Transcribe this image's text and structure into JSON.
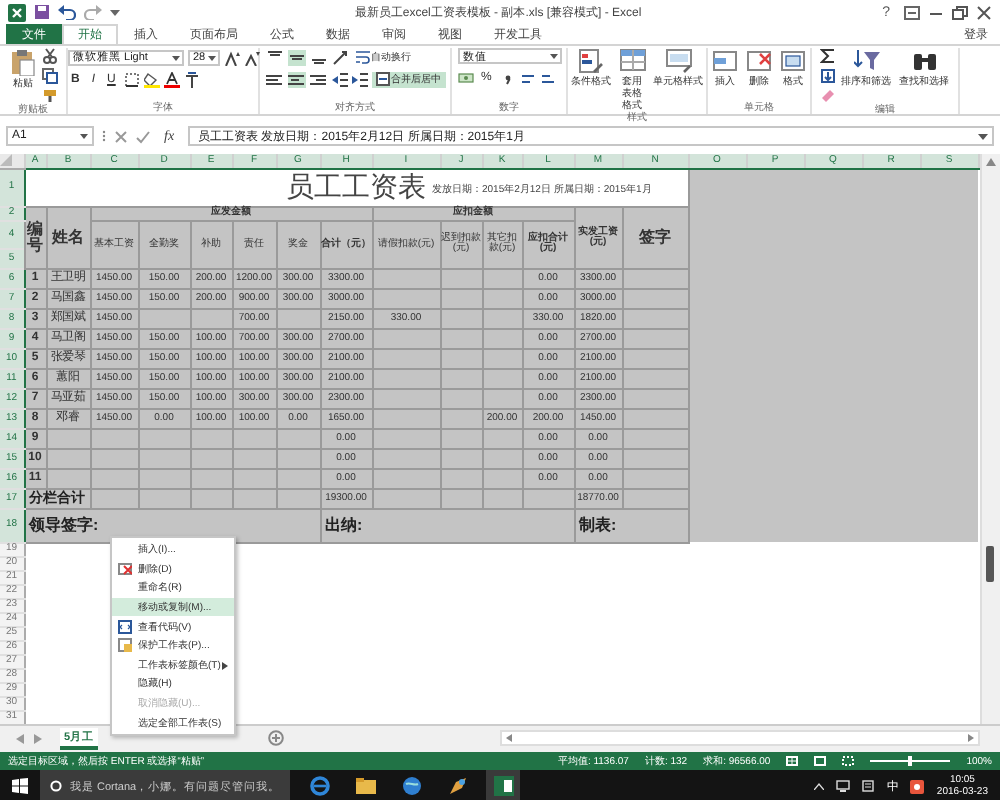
{
  "window": {
    "title": "最新员工excel工资表模板 - 副本.xls  [兼容模式] - Excel",
    "help": "?",
    "sign_in": "登录"
  },
  "ribbon": {
    "tabs": [
      {
        "label": "文件",
        "kind": "file",
        "selected": false
      },
      {
        "label": "开始",
        "kind": "tab",
        "selected": true
      },
      {
        "label": "插入",
        "kind": "tab",
        "selected": false
      },
      {
        "label": "页面布局",
        "kind": "tab",
        "selected": false
      },
      {
        "label": "公式",
        "kind": "tab",
        "selected": false
      },
      {
        "label": "数据",
        "kind": "tab",
        "selected": false
      },
      {
        "label": "审阅",
        "kind": "tab",
        "selected": false
      },
      {
        "label": "视图",
        "kind": "tab",
        "selected": false
      },
      {
        "label": "开发工具",
        "kind": "tab",
        "selected": false
      }
    ],
    "clipboard": {
      "label": "剪贴板",
      "paste": "粘贴"
    },
    "font": {
      "label": "字体",
      "name": "微软雅黑 Light",
      "size": "28",
      "styles": [
        "B",
        "I",
        "U"
      ]
    },
    "alignment": {
      "label": "对齐方式",
      "wrap": "自动换行",
      "merge": {
        "label": "合并后居中",
        "on": true
      },
      "vertical": [
        {
          "on": false
        },
        {
          "on": true
        },
        {
          "on": false
        }
      ],
      "horizontal": [
        {
          "on": false
        },
        {
          "on": true
        },
        {
          "on": false
        }
      ]
    },
    "number": {
      "label": "数字",
      "format": "数值",
      "percent": "%"
    },
    "styles": {
      "label": "样式",
      "buttons": [
        "条件格式",
        "套用表格格式",
        "单元格样式"
      ]
    },
    "cells": {
      "label": "单元格",
      "buttons": [
        "插入",
        "删除",
        "格式"
      ]
    },
    "editing": {
      "label": "编辑",
      "buttons": [
        "排序和筛选",
        "查找和选择"
      ]
    }
  },
  "formula_bar": {
    "name_box": "A1",
    "fx": "fx",
    "content": "员工工资表  发放日期：2015年2月12日  所属日期：2015年1月"
  },
  "sheet": {
    "columns": [
      {
        "label": "A",
        "selected": true
      },
      {
        "label": "B",
        "selected": true
      },
      {
        "label": "C",
        "selected": true
      },
      {
        "label": "D",
        "selected": true
      },
      {
        "label": "E",
        "selected": true
      },
      {
        "label": "F",
        "selected": true
      },
      {
        "label": "G",
        "selected": true
      },
      {
        "label": "H",
        "selected": true
      },
      {
        "label": "I",
        "selected": true
      },
      {
        "label": "J",
        "selected": true
      },
      {
        "label": "K",
        "selected": true
      },
      {
        "label": "L",
        "selected": true
      },
      {
        "label": "M",
        "selected": true
      },
      {
        "label": "N",
        "selected": true
      },
      {
        "label": "O",
        "selected": true
      },
      {
        "label": "P",
        "selected": true
      },
      {
        "label": "Q",
        "selected": true
      },
      {
        "label": "R",
        "selected": true
      },
      {
        "label": "S",
        "selected": true
      }
    ],
    "row_headers": [
      {
        "label": "1",
        "selected": true
      },
      {
        "label": "2",
        "selected": true
      },
      {
        "label": "4",
        "selected": true
      },
      {
        "label": "5",
        "selected": true
      },
      {
        "label": "6",
        "selected": true
      },
      {
        "label": "7",
        "selected": true
      },
      {
        "label": "8",
        "selected": true
      },
      {
        "label": "9",
        "selected": true
      },
      {
        "label": "10",
        "selected": true
      },
      {
        "label": "11",
        "selected": true
      },
      {
        "label": "12",
        "selected": true
      },
      {
        "label": "13",
        "selected": true
      },
      {
        "label": "14",
        "selected": true
      },
      {
        "label": "15",
        "selected": true
      },
      {
        "label": "16",
        "selected": true
      },
      {
        "label": "17",
        "selected": true
      },
      {
        "label": "18",
        "selected": true
      },
      {
        "label": "19",
        "selected": false
      },
      {
        "label": "20",
        "selected": false
      },
      {
        "label": "21",
        "selected": false
      },
      {
        "label": "22",
        "selected": false
      },
      {
        "label": "23",
        "selected": false
      },
      {
        "label": "24",
        "selected": false
      },
      {
        "label": "25",
        "selected": false
      },
      {
        "label": "26",
        "selected": false
      },
      {
        "label": "27",
        "selected": false
      },
      {
        "label": "28",
        "selected": false
      },
      {
        "label": "29",
        "selected": false
      },
      {
        "label": "30",
        "selected": false
      },
      {
        "label": "31",
        "selected": false
      }
    ],
    "title": "员工工资表",
    "date_line": "发放日期：2015年2月12日 所属日期：2015年1月",
    "head": {
      "number": "编号",
      "name": "姓名",
      "earnings": "应发金额",
      "deductions": "应扣金额",
      "net": "实发工资(元)",
      "signature": "签字",
      "earning_items": [
        "基本工资",
        "全勤奖",
        "补助",
        "责任",
        "奖金",
        "合计（元）"
      ],
      "deduction_items": [
        "请假扣款(元)",
        "迟到扣款(元)",
        "其它扣款(元)",
        "应扣合计(元)"
      ]
    },
    "rows": [
      [
        "1",
        "王卫明",
        "1450.00",
        "150.00",
        "200.00",
        "1200.00",
        "300.00",
        "3300.00",
        null,
        null,
        null,
        "0.00",
        "3300.00",
        null
      ],
      [
        "2",
        "马国鑫",
        "1450.00",
        "150.00",
        "200.00",
        "900.00",
        "300.00",
        "3000.00",
        null,
        null,
        null,
        "0.00",
        "3000.00",
        null
      ],
      [
        "3",
        "郑国斌",
        "1450.00",
        null,
        null,
        "700.00",
        null,
        "2150.00",
        "330.00",
        null,
        null,
        "330.00",
        "1820.00",
        null
      ],
      [
        "4",
        "马卫阁",
        "1450.00",
        "150.00",
        "100.00",
        "700.00",
        "300.00",
        "2700.00",
        null,
        null,
        null,
        "0.00",
        "2700.00",
        null
      ],
      [
        "5",
        "张爱琴",
        "1450.00",
        "150.00",
        "100.00",
        "100.00",
        "300.00",
        "2100.00",
        null,
        null,
        null,
        "0.00",
        "2100.00",
        null
      ],
      [
        "6",
        "蕙阳",
        "1450.00",
        "150.00",
        "100.00",
        "100.00",
        "300.00",
        "2100.00",
        null,
        null,
        null,
        "0.00",
        "2100.00",
        null
      ],
      [
        "7",
        "马亚茹",
        "1450.00",
        "150.00",
        "100.00",
        "300.00",
        "300.00",
        "2300.00",
        null,
        null,
        null,
        "0.00",
        "2300.00",
        null
      ],
      [
        "8",
        "邓睿",
        "1450.00",
        "0.00",
        "100.00",
        "100.00",
        "0.00",
        "1650.00",
        null,
        null,
        "200.00",
        "200.00",
        "1450.00",
        null
      ],
      [
        "9",
        null,
        null,
        null,
        null,
        null,
        null,
        "0.00",
        null,
        null,
        null,
        "0.00",
        "0.00",
        null
      ],
      [
        "10",
        null,
        null,
        null,
        null,
        null,
        null,
        "0.00",
        null,
        null,
        null,
        "0.00",
        "0.00",
        null
      ],
      [
        "11",
        null,
        null,
        null,
        null,
        null,
        null,
        "0.00",
        null,
        null,
        null,
        "0.00",
        "0.00",
        null
      ]
    ],
    "total": {
      "label": "分栏合计",
      "cells": [
        null,
        null,
        null,
        null,
        null,
        "19300.00",
        null,
        null,
        null,
        null,
        "18770.00",
        null
      ]
    },
    "signatures": [
      "领导签字:",
      "出纳:",
      "制表:"
    ]
  },
  "context_menu": [
    {
      "label": "插入(I)...",
      "selected": false,
      "disabled": false,
      "submenu": false
    },
    {
      "label": "删除(D)",
      "selected": false,
      "disabled": false,
      "submenu": false
    },
    {
      "label": "重命名(R)",
      "selected": false,
      "disabled": false,
      "submenu": false
    },
    {
      "label": "移动或复制(M)...",
      "selected": true,
      "disabled": false,
      "submenu": false
    },
    {
      "label": "查看代码(V)",
      "selected": false,
      "disabled": false,
      "submenu": false
    },
    {
      "label": "保护工作表(P)...",
      "selected": false,
      "disabled": false,
      "submenu": false
    },
    {
      "label": "工作表标签颜色(T)",
      "selected": false,
      "disabled": false,
      "submenu": true
    },
    {
      "label": "隐藏(H)",
      "selected": false,
      "disabled": false,
      "submenu": false
    },
    {
      "label": "取消隐藏(U)...",
      "selected": false,
      "disabled": true,
      "submenu": false
    },
    {
      "label": "选定全部工作表(S)",
      "selected": false,
      "disabled": false,
      "submenu": false
    }
  ],
  "sheet_tabs": [
    {
      "label": "5月工",
      "selected": true
    }
  ],
  "status_bar": {
    "message": "选定目标区域，然后按 ENTER 或选择“粘贴”",
    "average": "平均值: 1136.07",
    "count": "计数: 132",
    "sum": "求和: 96566.00",
    "zoom": "100%",
    "zoom_slider": {
      "level": 0.5
    }
  },
  "taskbar": {
    "search": "我是 Cortana，小娜。有问题尽管问我。",
    "ime": "中",
    "time": "10:05",
    "date": "2016-03-23"
  }
}
